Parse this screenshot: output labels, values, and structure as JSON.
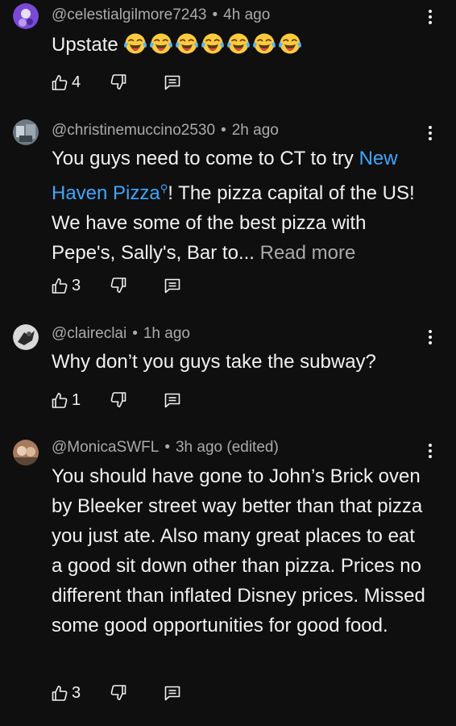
{
  "comments": [
    {
      "handle": "@celestialgilmore7243",
      "separator": "•",
      "time": "4h ago",
      "text": "Upstate",
      "emoji_name": "face-with-tears-of-joy",
      "emoji_count": 7,
      "likes": "4",
      "avatar_colors": [
        "#7a4ad6",
        "#e6dfff"
      ]
    },
    {
      "handle": "@christinemuccino2530",
      "separator": "•",
      "time": "2h ago",
      "text_before_link": "You guys need to come to CT to try ",
      "link_text": "New Haven Pizza",
      "link_icon": "search-icon",
      "text_after_link": "!  The pizza capital of the US! We have some of the best pizza with Pepe's, Sally's, Bar to... ",
      "read_more": "Read more",
      "likes": "3",
      "avatar_colors": [
        "#6c7a86",
        "#c9d2d9"
      ]
    },
    {
      "handle": "@claireclai",
      "separator": "•",
      "time": "1h ago",
      "text": "Why don’t you guys take the subway?",
      "likes": "1",
      "avatar_colors": [
        "#d9d9d9",
        "#2a2a2a"
      ]
    },
    {
      "handle": "@MonicaSWFL",
      "separator": "•",
      "time": "3h ago (edited)",
      "text": "You should have gone to John’s Brick oven by Bleeker street way better than that pizza you just ate. Also many great places to eat a good sit down other than pizza.  Prices no different than inflated Disney prices.  Missed some good opportunities for good food.",
      "likes": "3",
      "avatar_colors": [
        "#a87a5e",
        "#e8cdb4"
      ]
    }
  ],
  "icons": {
    "like": "thumbs-up-icon",
    "dislike": "thumbs-down-icon",
    "reply": "reply-icon",
    "more": "more-vertical-icon"
  },
  "colors": {
    "background": "#0f0f0f",
    "text": "#f1f1f1",
    "secondary_text": "#aaaaaa",
    "link": "#3ea6ff"
  }
}
